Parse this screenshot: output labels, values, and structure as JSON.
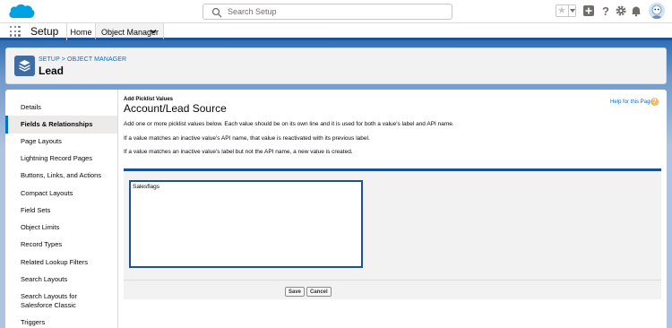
{
  "global_header": {
    "search_placeholder": "Search Setup",
    "icons": [
      "salesforce-cloud-logo",
      "search-icon",
      "favorites-star-icon",
      "add-icon",
      "help-icon",
      "setup-gear-icon",
      "notifications-bell-icon",
      "user-avatar"
    ]
  },
  "context_bar": {
    "app_name": "Setup",
    "tabs": [
      {
        "label": "Home"
      },
      {
        "label": "Object Manager"
      }
    ]
  },
  "object_header": {
    "breadcrumb": "SETUP > OBJECT MANAGER",
    "title": "Lead"
  },
  "sidebar": {
    "items": [
      {
        "label": "Details"
      },
      {
        "label": "Fields & Relationships"
      },
      {
        "label": "Page Layouts"
      },
      {
        "label": "Lightning Record Pages"
      },
      {
        "label": "Buttons, Links, and Actions"
      },
      {
        "label": "Compact Layouts"
      },
      {
        "label": "Field Sets"
      },
      {
        "label": "Object Limits"
      },
      {
        "label": "Record Types"
      },
      {
        "label": "Related Lookup Filters"
      },
      {
        "label": "Search Layouts"
      },
      {
        "label": "Search Layouts for Salesforce Classic"
      },
      {
        "label": "Triggers"
      }
    ],
    "active_index": 1
  },
  "main": {
    "pre_title": "Add Picklist Values",
    "title": "Account/Lead Source",
    "help_link": "Help for this Page",
    "help_icon_glyph": "?",
    "descriptions": [
      "Add one or more picklist values below. Each value should be on its own line and it is used for both a value's label and API name.",
      "If a value matches an inactive value's API name, that value is reactivated with its previous label.",
      "If a value matches an inactive value's label but not the API name, a new value is created."
    ],
    "picklist_value": "Salesflags",
    "save_label": "Save",
    "cancel_label": "Cancel"
  },
  "colors": {
    "brand_blue": "#1b5297",
    "link_blue": "#0070d2",
    "help_orange": "#ffb75d",
    "object_icon": "#3e6ca3"
  }
}
